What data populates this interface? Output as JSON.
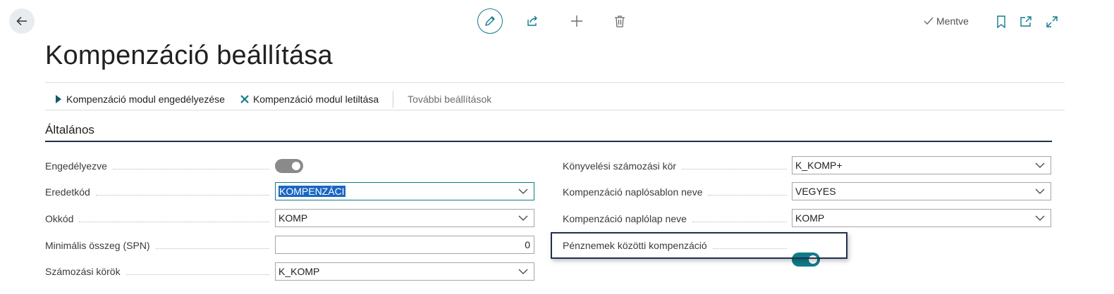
{
  "header": {
    "saved_label": "Mentve",
    "page_title": "Kompenzáció beállítása"
  },
  "actions": {
    "enable_label": "Kompenzáció modul engedélyezése",
    "disable_label": "Kompenzáció modul letiltása",
    "more_label": "További beállítások"
  },
  "section": {
    "title": "Általános"
  },
  "fields_left": {
    "enabled": {
      "label": "Engedélyezve",
      "state": "off"
    },
    "source_code": {
      "label": "Eredetkód",
      "value": "KOMPENZÁCI"
    },
    "reason_code": {
      "label": "Okkód",
      "value": "KOMP"
    },
    "min_amount": {
      "label": "Minimális összeg (SPN)",
      "value": "0"
    },
    "number_series": {
      "label": "Számozási körök",
      "value": "K_KOMP"
    }
  },
  "fields_right": {
    "posting_nos": {
      "label": "Könyvelési számozási kör",
      "value": "K_KOMP+"
    },
    "journal_template": {
      "label": "Kompenzáció naplósablon neve",
      "value": "VEGYES"
    },
    "journal_batch": {
      "label": "Kompenzáció naplólap neve",
      "value": "KOMP"
    },
    "cross_currency": {
      "label": "Pénznemek közötti kompenzáció",
      "state": "on"
    }
  },
  "colors": {
    "accent": "#0f7b8a",
    "toggle_off": "#8a8a8a",
    "highlight_border": "#22304d"
  }
}
